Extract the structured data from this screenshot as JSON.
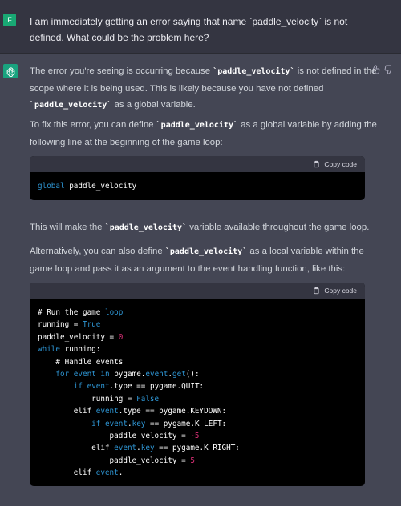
{
  "user_message": {
    "avatar_letter": "F",
    "text": "I am immediately getting an error saying that name `paddle_velocity` is not defined. What could be the problem here?"
  },
  "assistant": {
    "para1": {
      "a": "The error you're seeing is occurring because ",
      "b": " is not defined in the scope where it is being used. This is likely because you have not defined ",
      "c": " as a global variable."
    },
    "para2": {
      "a": "To fix this error, you can define ",
      "b": " as a global variable by adding the following line at the beginning of the game loop:"
    },
    "code1": {
      "copy_label": "Copy code",
      "keyword": "global",
      "rest": " paddle_velocity"
    },
    "para3": {
      "a": "This will make the ",
      "b": " variable available throughout the game loop."
    },
    "para4": {
      "a": "Alternatively, you can also define ",
      "b": " as a local variable within the game loop and pass it as an argument to the event handling function, like this:"
    },
    "code2": {
      "copy_label": "Copy code"
    },
    "inline_code": "`paddle_velocity`"
  },
  "colors": {
    "user_bg": "#343541",
    "assistant_bg": "#444654",
    "code_bg": "#000000",
    "keyword": "#2e95d3",
    "number": "#df3079",
    "avatar_user": "#19a974",
    "avatar_gpt": "#19a37f"
  },
  "icons": [
    "openai-logo-icon",
    "thumbs-up-icon",
    "thumbs-down-icon",
    "clipboard-icon"
  ]
}
